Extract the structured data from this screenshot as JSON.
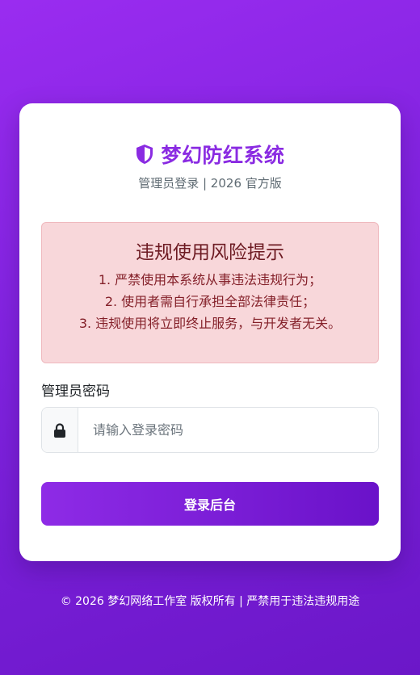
{
  "brand": {
    "title": "梦幻防红系统",
    "icon": "shield-half-icon",
    "accent_color": "#8a2be2"
  },
  "subtitle": "管理员登录 | 2026 官方版",
  "alert": {
    "title": "违规使用风险提示",
    "lines": [
      "1. 严禁使用本系统从事违法违规行为；",
      "2. 使用者需自行承担全部法律责任；",
      "3. 违规使用将立即终止服务，与开发者无关。"
    ]
  },
  "password_field": {
    "label": "管理员密码",
    "placeholder": "请输入登录密码",
    "value": "",
    "icon": "lock-icon"
  },
  "login_button": {
    "label": "登录后台"
  },
  "footer": {
    "text": "© 2026 梦幻网络工作室 版权所有 | 严禁用于违法违规用途"
  }
}
